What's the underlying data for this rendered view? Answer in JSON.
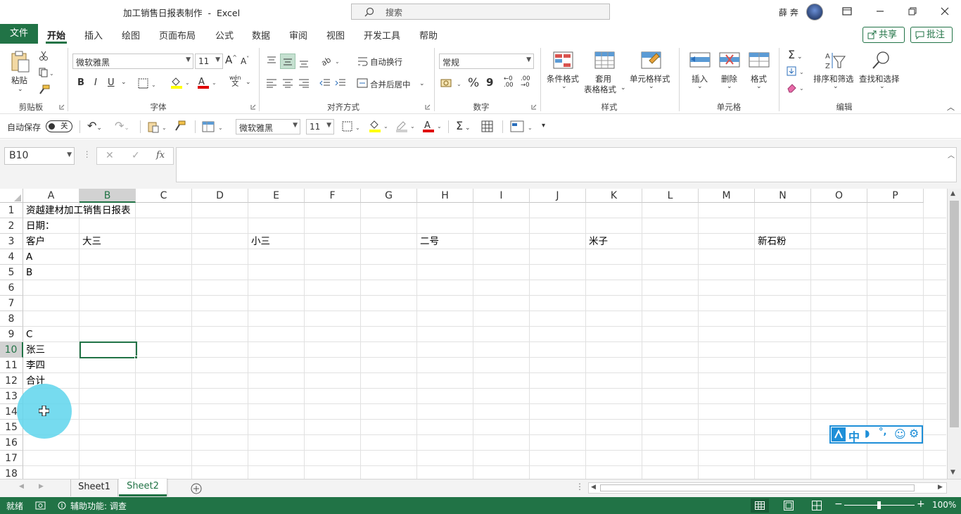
{
  "title": {
    "doc_name": "加工销售日报表制作",
    "separator": "-",
    "app": "Excel",
    "search_placeholder": "搜索",
    "user": "薛 奔"
  },
  "menu": {
    "tabs": [
      "文件",
      "开始",
      "插入",
      "绘图",
      "页面布局",
      "公式",
      "数据",
      "审阅",
      "视图",
      "开发工具",
      "帮助"
    ],
    "active": "开始",
    "share": "共享",
    "comment": "批注"
  },
  "ribbon": {
    "clipboard": {
      "paste": "粘贴",
      "label": "剪贴板"
    },
    "font": {
      "name": "微软雅黑",
      "size": "11",
      "bold": "B",
      "italic": "I",
      "underline": "U",
      "label": "字体",
      "grow": "A",
      "shrink": "A",
      "wen": "wén",
      "wenzi": "文"
    },
    "alignment": {
      "wrap": "自动换行",
      "merge": "合并后居中",
      "label": "对齐方式"
    },
    "number": {
      "format": "常规",
      "percent": "%",
      "comma": "9",
      "inc": "←0",
      "dec": ".00",
      "label": "数字"
    },
    "styles": {
      "cond": "条件格式",
      "table1": "套用",
      "table2": "表格格式",
      "cellstyle": "单元格样式",
      "label": "样式"
    },
    "cells": {
      "insert": "插入",
      "delete": "删除",
      "format": "格式",
      "label": "单元格"
    },
    "editing": {
      "sort": "排序和筛选",
      "find": "查找和选择",
      "label": "编辑"
    }
  },
  "qat": {
    "autosave": "自动保存",
    "toggle": "关",
    "font": "微软雅黑",
    "size": "11"
  },
  "formula_bar": {
    "name_box": "B10",
    "fx": "fx",
    "value": ""
  },
  "columns": [
    "A",
    "B",
    "C",
    "D",
    "E",
    "F",
    "G",
    "H",
    "I",
    "J",
    "K",
    "L",
    "M",
    "N",
    "O",
    "P"
  ],
  "rows": [
    "1",
    "2",
    "3",
    "4",
    "5",
    "6",
    "7",
    "8",
    "9",
    "10",
    "11",
    "12",
    "13",
    "14",
    "15",
    "16",
    "17",
    "18"
  ],
  "cells": [
    {
      "ref": "A1",
      "value": "资越建材加工销售日报表"
    },
    {
      "ref": "A2",
      "value": "日期："
    },
    {
      "ref": "A3",
      "value": "客户"
    },
    {
      "ref": "B3",
      "value": "大三"
    },
    {
      "ref": "E3",
      "value": "小三"
    },
    {
      "ref": "H3",
      "value": "二号"
    },
    {
      "ref": "K3",
      "value": "米子"
    },
    {
      "ref": "N3",
      "value": "新石粉"
    },
    {
      "ref": "A4",
      "value": "A"
    },
    {
      "ref": "A5",
      "value": "B"
    },
    {
      "ref": "A9",
      "value": "C"
    },
    {
      "ref": "A10",
      "value": "张三"
    },
    {
      "ref": "A11",
      "value": "李四"
    },
    {
      "ref": "A12",
      "value": "合计"
    }
  ],
  "selected_cell": "B10",
  "sheets": {
    "tabs": [
      "Sheet1",
      "Sheet2"
    ],
    "active": "Sheet2"
  },
  "ime": {
    "zhong": "中",
    "punct": "°,"
  },
  "status": {
    "ready": "就绪",
    "accessibility": "辅助功能: 调查",
    "zoom": "100%"
  },
  "colors": {
    "accent": "#217346",
    "selection": "#217346",
    "cursor_halo": "#5ed5ec"
  }
}
